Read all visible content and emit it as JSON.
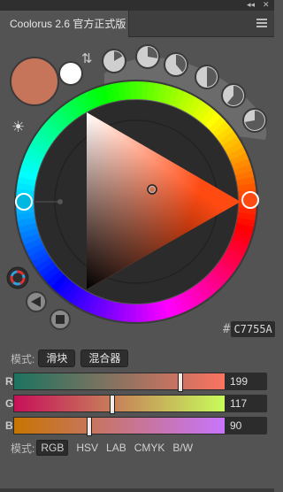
{
  "window": {
    "controls": [
      "◂◂",
      "✕"
    ],
    "tab_title": "Coolorus 2.6 官方正式版",
    "menu_icon": "menu-icon"
  },
  "colors": {
    "current": "#C7755A",
    "hue_angle_deg": 15,
    "triangle_tip": "#ff4a12"
  },
  "hex": {
    "prefix": "#",
    "value": "C7755A"
  },
  "mode_bar": {
    "label": "模式:",
    "buttons": [
      "滑块",
      "混合器"
    ]
  },
  "sliders": [
    {
      "channel": "R",
      "value": "199",
      "fraction": 0.78,
      "from": "#1c7360",
      "to": "#ff7361"
    },
    {
      "channel": "G",
      "value": "117",
      "fraction": 0.46,
      "from": "#c7105a",
      "to": "#c7ff5a"
    },
    {
      "channel": "B",
      "value": "90",
      "fraction": 0.353,
      "from": "#c77500",
      "to": "#c775ff"
    }
  ],
  "color_modes": {
    "label": "模式:",
    "items": [
      "RGB",
      "HSV",
      "LAB",
      "CMYK",
      "B/W"
    ],
    "active": "RGB"
  }
}
